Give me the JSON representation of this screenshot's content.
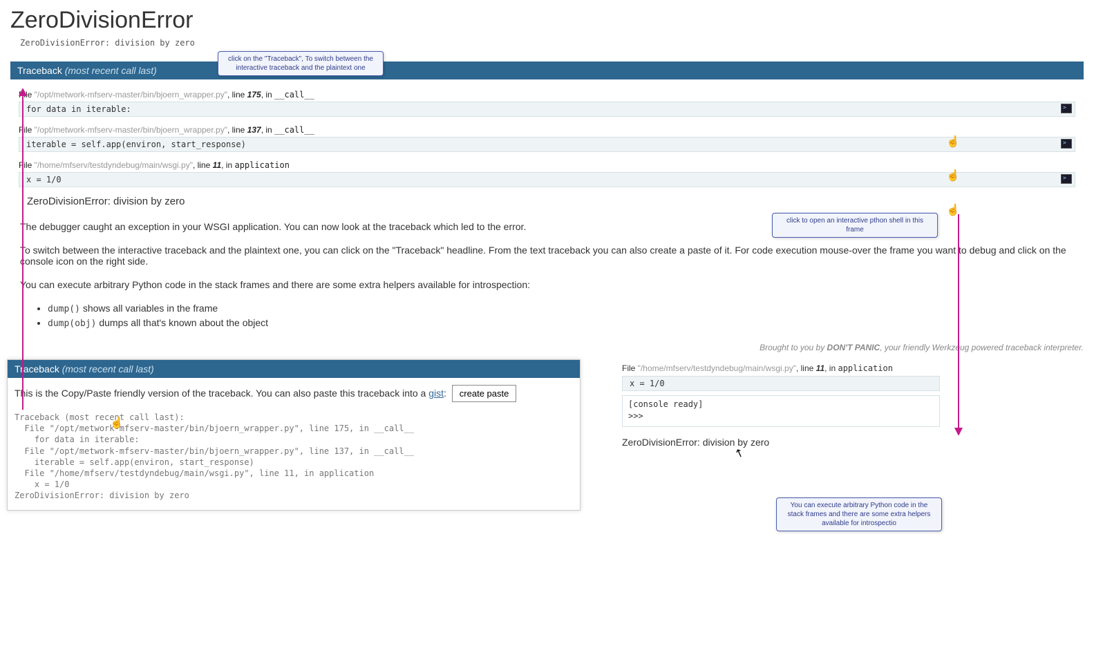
{
  "title": "ZeroDivisionError",
  "exception_line": "ZeroDivisionError: division by zero",
  "callouts": {
    "traceback": "click on the \"Traceback\", To switch between the interactive traceback and the plaintext one",
    "console": "click to open an interactive pthon shell in this frame",
    "exec": "You can execute arbitrary Python code in the stack frames and there are some extra helpers available for introspectio"
  },
  "traceback": {
    "header_label": "Traceback",
    "header_suffix": "(most recent call last)",
    "frames": [
      {
        "file_prefix": "File ",
        "file_path": "\"/opt/metwork-mfserv-master/bin/bjoern_wrapper.py\"",
        "line_text": ", line ",
        "line_no": "175",
        "in_text": ", in ",
        "func": "__call__",
        "code": "for data in iterable:"
      },
      {
        "file_prefix": "File ",
        "file_path": "\"/opt/metwork-mfserv-master/bin/bjoern_wrapper.py\"",
        "line_text": ", line ",
        "line_no": "137",
        "in_text": ", in ",
        "func": "__call__",
        "code": "iterable = self.app(environ, start_response)"
      },
      {
        "file_prefix": "File ",
        "file_path": "\"/home/mfserv/testdyndebug/main/wsgi.py\"",
        "line_text": ", line ",
        "line_no": "11",
        "in_text": ", in ",
        "func": "application",
        "code": "x = 1/0"
      }
    ],
    "error_summary": "ZeroDivisionError: division by zero"
  },
  "description": {
    "p1": "The debugger caught an exception in your WSGI application. You can now look at the traceback which led to the error.",
    "p2": "To switch between the interactive traceback and the plaintext one, you can click on the \"Traceback\" headline. From the text traceback you can also create a paste of it. For code execution mouse-over the frame you want to debug and click on the console icon on the right side.",
    "p3": "You can execute arbitrary Python code in the stack frames and there are some extra helpers available for introspection:",
    "li1_code": "dump()",
    "li1_text": " shows all variables in the frame",
    "li2_code": "dump(obj)",
    "li2_text": " dumps all that's known about the object"
  },
  "footer": {
    "prefix": "Brought to you by ",
    "bold": "DON'T PANIC",
    "suffix": ", your friendly Werkzeug powered traceback interpreter."
  },
  "plaintext": {
    "header_label": "Traceback",
    "header_suffix": "(most recent call last)",
    "intro_text": "This is the Copy/Paste friendly version of the traceback. You can also paste this traceback into a ",
    "gist_label": "gist",
    "intro_text2": ": ",
    "create_paste_label": "create paste",
    "lines": [
      "Traceback (most recent call last):",
      "  File \"/opt/metwork-mfserv-master/bin/bjoern_wrapper.py\", line 175, in __call__",
      "    for data in iterable:",
      "  File \"/opt/metwork-mfserv-master/bin/bjoern_wrapper.py\", line 137, in __call__",
      "    iterable = self.app(environ, start_response)",
      "  File \"/home/mfserv/testdyndebug/main/wsgi.py\", line 11, in application",
      "    x = 1/0",
      "ZeroDivisionError: division by zero"
    ]
  },
  "console": {
    "frame": {
      "file_prefix": "File ",
      "file_path": "\"/home/mfserv/testdyndebug/main/wsgi.py\"",
      "line_text": ", line ",
      "line_no": "11",
      "in_text": ", in ",
      "func": "application"
    },
    "code": "x = 1/0",
    "ready": "[console ready]",
    "prompt": ">>>",
    "error": "ZeroDivisionError: division by zero"
  }
}
